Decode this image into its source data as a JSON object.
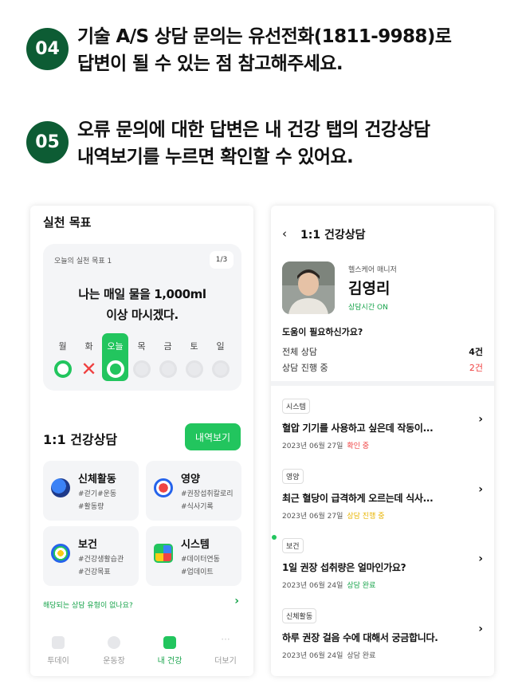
{
  "steps": [
    {
      "num": "04",
      "line1": "기술 A/S 상담 문의는 유선전화(1811-9988)로",
      "line2": "답변이 될 수 있는 점 참고해주세요."
    },
    {
      "num": "05",
      "line1": "오류 문의에 대한 답변은 내 건강 탭의 건강상담",
      "line2": "내역보기를 누르면 확인할 수 있어요."
    }
  ],
  "left": {
    "section_title": "실천 목표",
    "goal_sub": "오늘의 실천 목표 1",
    "pager": "1/3",
    "goal_line1": "나는 매일 물을 1,000ml",
    "goal_line2": "이상 마시겠다.",
    "days": [
      "월",
      "화",
      "오늘",
      "목",
      "금",
      "토",
      "일"
    ],
    "consult_title": "1:1 건강상담",
    "detail_button": "내역보기",
    "categories": [
      {
        "title": "신체활동",
        "h1": "#걷기#운동",
        "h2": "#활동량"
      },
      {
        "title": "영양",
        "h1": "#권장섭취칼로리",
        "h2": "#식사기록"
      },
      {
        "title": "보건",
        "h1": "#건강생활습관",
        "h2": "#건강목표"
      },
      {
        "title": "시스템",
        "h1": "#데이터연동",
        "h2": "#업데이트"
      }
    ],
    "ask_link": "해당되는 상담 유형이 없나요?",
    "tabs": [
      "투데이",
      "운동장",
      "내 건강",
      "더보기"
    ]
  },
  "right": {
    "title": "1:1 건강상담",
    "manager_role": "헬스케어 매니저",
    "manager_name": "김영리",
    "manager_status": "상담시간 ON",
    "help": "도움이 필요하신가요?",
    "total_label": "전체 상담",
    "total_value": "4건",
    "progress_label": "상담 진행 중",
    "progress_value": "2건",
    "items": [
      {
        "tag": "시스템",
        "q": "혈압 기기를 사용하고 싶은데 작동이...",
        "date": "2023년 06월 27일",
        "status": "확인 중",
        "status_color": "#ef3f3f"
      },
      {
        "tag": "영양",
        "q": "최근 혈당이 급격하게 오르는데 식사...",
        "date": "2023년 06월 27일",
        "status": "상담 진행 중",
        "status_color": "#e8b400"
      },
      {
        "tag": "보건",
        "q": "1일 권장 섭취량은 얼마인가요?",
        "date": "2023년 06월 24일",
        "status": "상담 완료",
        "status_color": "#16a34a"
      },
      {
        "tag": "신체활동",
        "q": "하루 권장 걸음 수에 대해서 궁금합니다.",
        "date": "2023년 06월 24일",
        "status": "상담 완료",
        "status_color": "#555555"
      }
    ]
  }
}
